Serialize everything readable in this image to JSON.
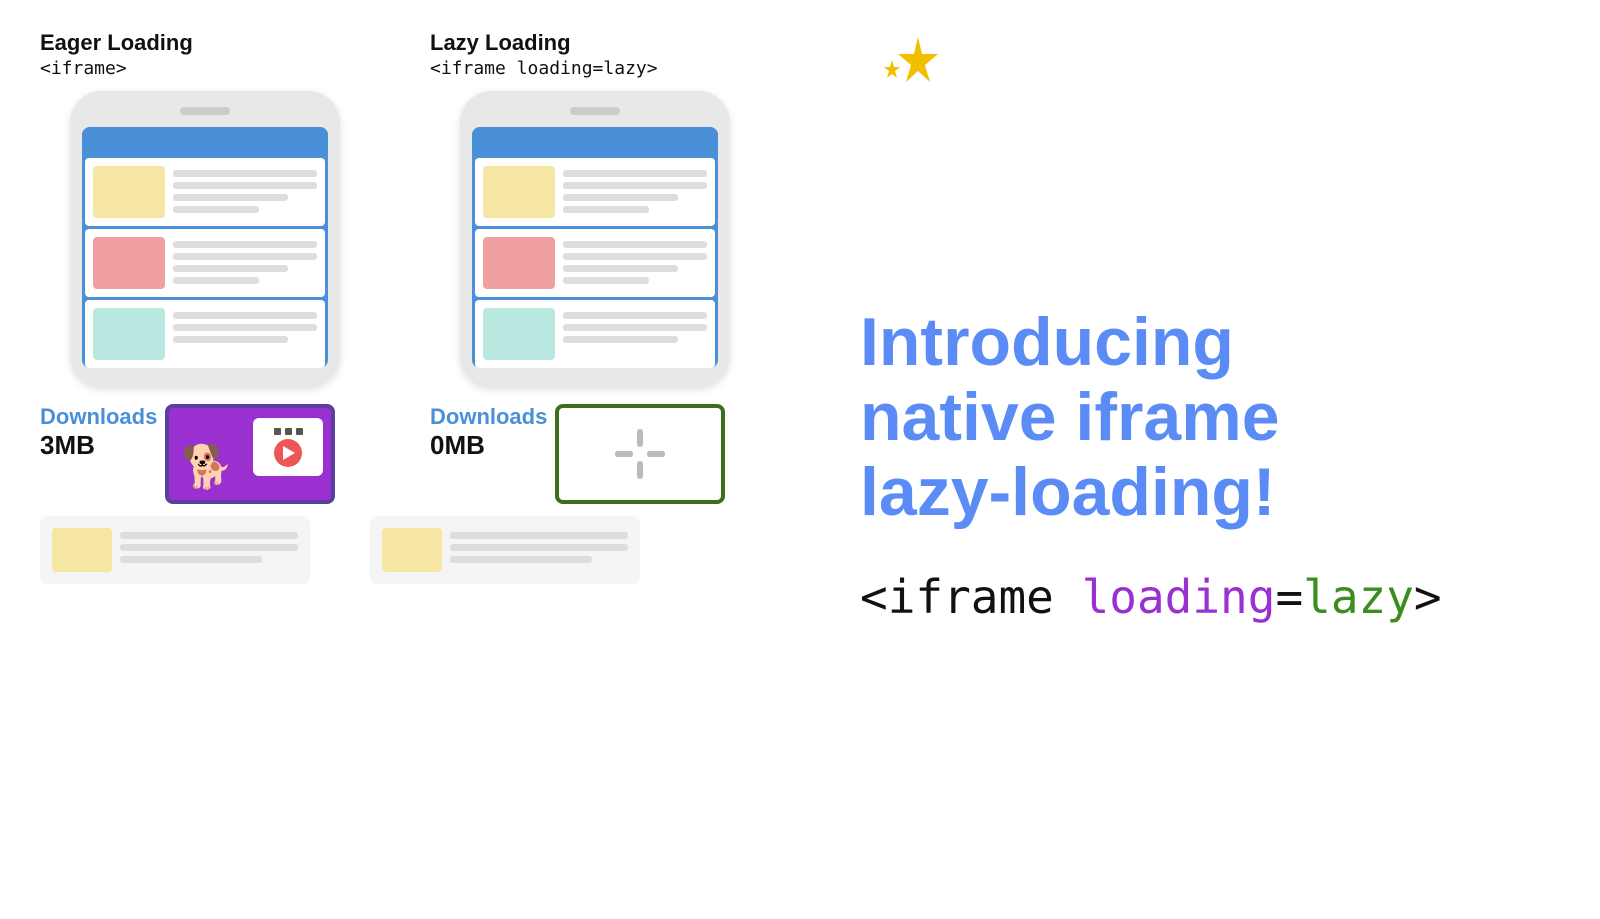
{
  "eager": {
    "title": "Eager Loading",
    "code": "<iframe>",
    "downloads_label": "Downloads",
    "downloads_value": "3MB"
  },
  "lazy": {
    "title": "Lazy Loading",
    "code": "<iframe loading=lazy>",
    "downloads_label": "Downloads",
    "downloads_value": "0MB"
  },
  "intro": {
    "line1": "Introducing",
    "line2": "native iframe",
    "line3": "lazy-loading!"
  },
  "code_snippet": {
    "prefix": "<iframe ",
    "keyword_loading": "loading",
    "equals": "=",
    "keyword_lazy": "lazy",
    "suffix": ">"
  }
}
